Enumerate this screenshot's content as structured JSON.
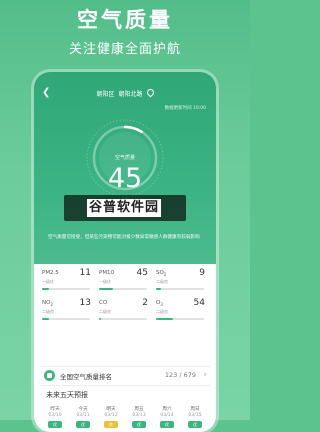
{
  "promo": {
    "title": "空气质量",
    "subtitle": "关注健康全面护航"
  },
  "header": {
    "district": "朝阳区",
    "street": "朝阳北路",
    "update_time": "数据更新时间 10:00"
  },
  "aqi": {
    "label": "空气质量",
    "value": "45",
    "level": "优",
    "gauge_fraction": 0.09,
    "advice": "空气质量可接受，但某些污染物可能对极少数异常敏感人群健康有较弱影响"
  },
  "watermark": {
    "text": "谷普软件园"
  },
  "pollutants": [
    {
      "name": "PM2.5",
      "level": "一级优",
      "value": "11",
      "fill": 0.15,
      "color": "#3db57f"
    },
    {
      "name": "PM10",
      "level": "一级优",
      "value": "45",
      "fill": 0.3,
      "color": "#3db57f"
    },
    {
      "name": "SO",
      "sub": "2",
      "level": "二级良",
      "value": "9",
      "fill": 0.1,
      "color": "#3db57f"
    },
    {
      "name": "NO",
      "sub": "2",
      "level": "二级良",
      "value": "13",
      "fill": 0.15,
      "color": "#3db57f"
    },
    {
      "name": "CO",
      "level": "二级良",
      "value": "2",
      "fill": 0.05,
      "color": "#3db57f"
    },
    {
      "name": "O",
      "sub": "3",
      "level": "二级良",
      "value": "54",
      "fill": 0.35,
      "color": "#3db57f"
    }
  ],
  "ranking": {
    "title": "全国空气质量排名",
    "value": "123 / 679"
  },
  "forecast": {
    "title": "未来五天预报",
    "days": [
      {
        "name": "昨天",
        "date": "03/10",
        "badge": "优",
        "color": "#3db57f"
      },
      {
        "name": "今天",
        "date": "03/11",
        "badge": "优",
        "color": "#3db57f"
      },
      {
        "name": "明天",
        "date": "03/12",
        "badge": "良",
        "color": "#e8c23a"
      },
      {
        "name": "周五",
        "date": "03/13",
        "badge": "优",
        "color": "#3db57f"
      },
      {
        "name": "周六",
        "date": "03/14",
        "badge": "优",
        "color": "#3db57f"
      },
      {
        "name": "周日",
        "date": "03/15",
        "badge": "优",
        "color": "#3db57f"
      }
    ]
  },
  "colors": {
    "primary": "#3db57f",
    "background": "#5cc38f",
    "warning": "#e8c23a"
  }
}
